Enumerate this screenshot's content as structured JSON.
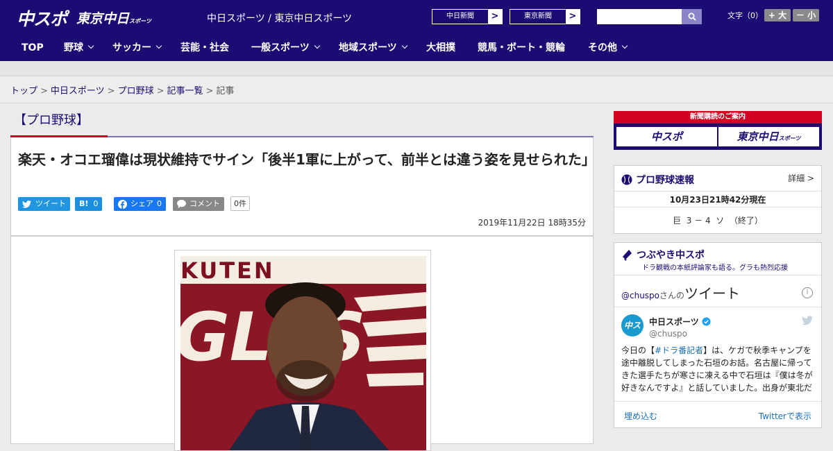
{
  "header": {
    "logo_chuspo": "中スポ",
    "logo_tokyo": "東京中日",
    "logo_tokyo_small": "スポーツ",
    "tagline": "中日スポーツ / 東京中日スポーツ",
    "paper_links": [
      {
        "label": "中日新聞",
        "arrow": ">"
      },
      {
        "label": "東京新聞",
        "arrow": ">"
      }
    ],
    "search": {
      "placeholder": "",
      "value": "",
      "icon": "search-icon"
    },
    "font_size_label": "文字（0）",
    "font_larger": "+ 大",
    "font_smaller": "－ 小"
  },
  "nav": {
    "items": [
      {
        "label": "TOP",
        "has_dropdown": false
      },
      {
        "label": "野球",
        "has_dropdown": true
      },
      {
        "label": "サッカー",
        "has_dropdown": true
      },
      {
        "label": "芸能・社会",
        "has_dropdown": false
      },
      {
        "label": "一般スポーツ",
        "has_dropdown": true
      },
      {
        "label": "地域スポーツ",
        "has_dropdown": true
      },
      {
        "label": "大相撲",
        "has_dropdown": false
      },
      {
        "label": "競馬・ボート・競輪",
        "has_dropdown": false
      },
      {
        "label": "その他",
        "has_dropdown": true
      }
    ]
  },
  "breadcrumb": {
    "items": [
      "トップ",
      "中日スポーツ",
      "プロ野球",
      "記事一覧",
      "記事"
    ],
    "separator": ">"
  },
  "article": {
    "category": "【プロ野球】",
    "title": "楽天・オコエ瑠偉は現状維持でサイン「後半1軍に上がって、前半とは違う姿を見せられた」",
    "share": {
      "tweet": "ツイート",
      "hatena_icon": "B!",
      "hatena_count": "0",
      "facebook": "シェア",
      "facebook_count": "0",
      "comment": "コメント",
      "comment_count": "0件"
    },
    "date": "2019年11月22日 18時35分",
    "photo": {
      "text": "KUTEN",
      "logo_text": "GLES"
    }
  },
  "sidebar": {
    "ad": {
      "top": "新聞購読のご案内",
      "left": "中スポ",
      "right": "東京中日",
      "right_small": "スポーツ"
    },
    "score": {
      "title": "プロ野球速報",
      "detail": "詳細 >",
      "time": "10月23日21時42分現在",
      "line": "巨  3 － 4  ソ  （終了）"
    },
    "tsubuyaki": {
      "title": "つぶやき中スポ",
      "subtitle": "ドラ観戦の本紙評論家も語る。グラも熱烈応援",
      "timeline": {
        "handle": "@chuspo",
        "san": "さんの",
        "heading": "ツイート",
        "info": "i",
        "avatar": "中スポ",
        "name": "中日スポーツ",
        "screen_name": "@chuspo",
        "text_pre": "今日の【",
        "hashtag": "#ドラ番記者",
        "text_post": "】は、ケガで秋季キャンプを途中離脱してしまった石垣のお話。名古屋に帰ってきた選手たちが寒さに凍える中で石垣は『僕は冬が好きなんですよ』と話していました。出身が東北だ",
        "embed": "埋め込む",
        "view_on_twitter": "Twitterで表示"
      }
    }
  },
  "colors": {
    "brand_navy": "#1a0c73",
    "brand_red": "#d00020",
    "twitter_blue": "#2196e0",
    "hatena_blue": "#1a8fe0",
    "facebook_blue": "#1877f2",
    "comment_gray": "#888888"
  }
}
